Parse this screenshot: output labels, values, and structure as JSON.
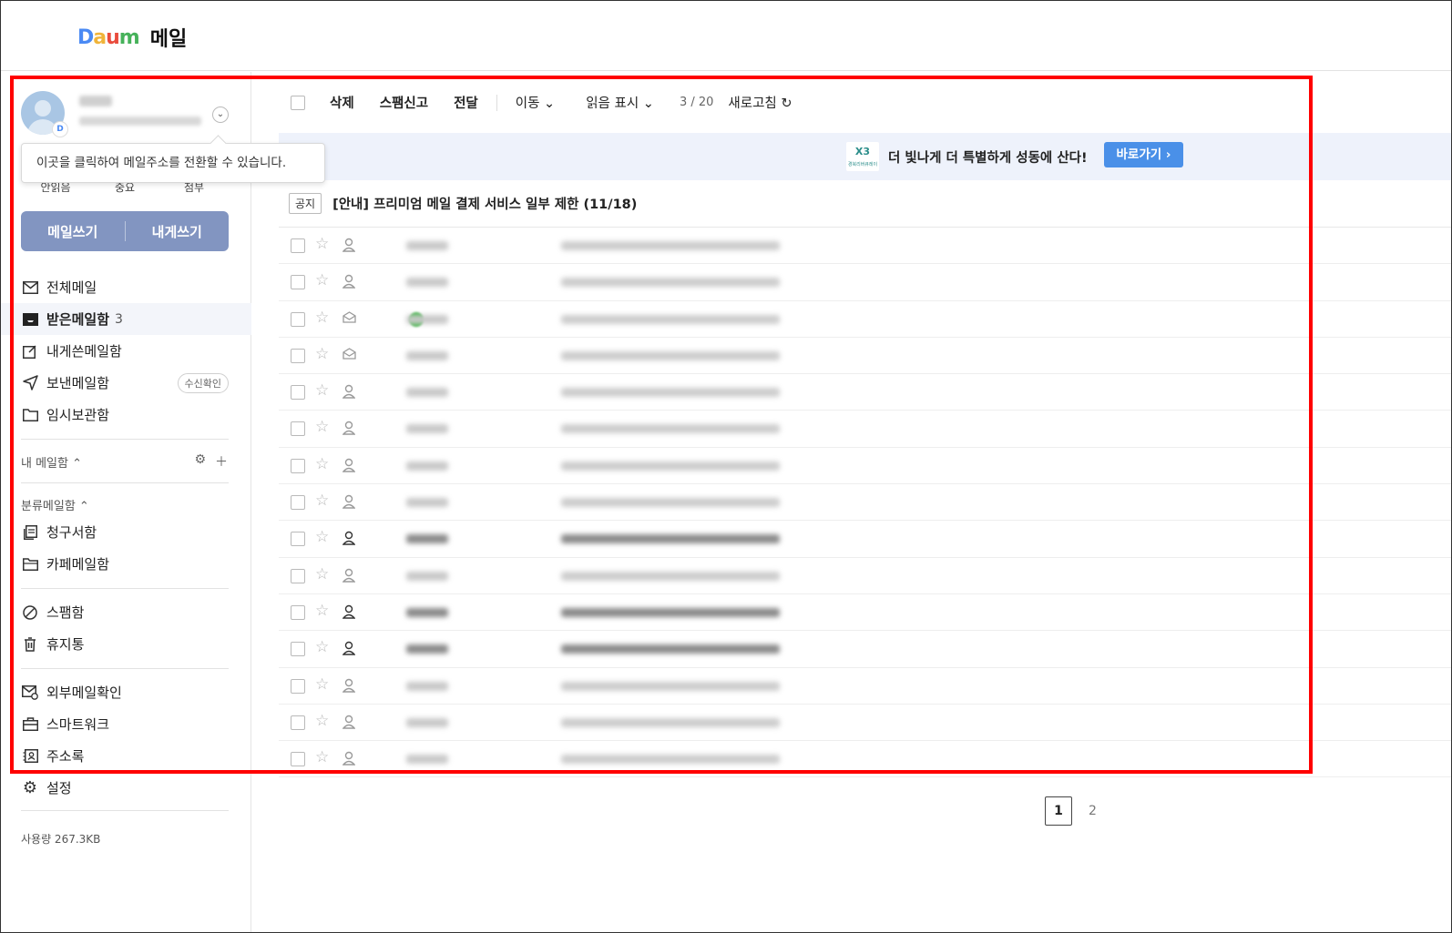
{
  "app": {
    "logo_text": "Daum",
    "title": "메일"
  },
  "sidebar": {
    "tooltip": "이곳을 클릭하여 메일주소를 전환할 수 있습니다.",
    "quick_tabs": [
      "안읽음",
      "중요",
      "첨부"
    ],
    "compose": {
      "write": "메일쓰기",
      "self": "내게쓰기"
    },
    "folders": [
      {
        "label": "전체메일",
        "icon": "envelope-icon"
      },
      {
        "label": "받은메일함",
        "count": "3",
        "icon": "inbox-icon",
        "active": true
      },
      {
        "label": "내게쓴메일함",
        "icon": "self-note-icon"
      },
      {
        "label": "보낸메일함",
        "icon": "send-icon",
        "pill": "수신확인"
      },
      {
        "label": "임시보관함",
        "icon": "folder-icon"
      }
    ],
    "my_mailbox": "내 메일함 ⌃",
    "category_title": "분류메일함 ⌃",
    "categories": [
      {
        "label": "청구서함",
        "icon": "bill-icon"
      },
      {
        "label": "카페메일함",
        "icon": "cafe-folder-icon"
      }
    ],
    "others": [
      {
        "label": "스팸함",
        "icon": "spam-icon"
      },
      {
        "label": "휴지통",
        "icon": "trash-icon"
      }
    ],
    "tools": [
      {
        "label": "외부메일확인",
        "icon": "external-mail-icon"
      },
      {
        "label": "스마트워크",
        "icon": "briefcase-icon"
      },
      {
        "label": "주소록",
        "icon": "contacts-icon"
      },
      {
        "label": "설정",
        "icon": "gear-icon"
      }
    ],
    "usage": "사용량 267.3KB"
  },
  "toolbar": {
    "delete": "삭제",
    "spam": "스팸신고",
    "forward": "전달",
    "move": "이동 ⌄",
    "mark_read": "읽음 표시 ⌄",
    "count": "3 / 20",
    "refresh": "새로고침 ↻"
  },
  "banner": {
    "logo": "X3",
    "logo_sub": "경북리버큐레이",
    "text": "더 빛나게 더 특별하게 성동에 산다!",
    "button": "바로가기 ›"
  },
  "notice": {
    "tag": "공지",
    "title": "[안내] 프리미엄 메일 결제 서비스 일부 제한 (11/18)"
  },
  "mails": [
    {
      "bold": false,
      "icon": "person"
    },
    {
      "bold": false,
      "icon": "person"
    },
    {
      "bold": false,
      "icon": "envelope",
      "green": true
    },
    {
      "bold": false,
      "icon": "envelope"
    },
    {
      "bold": false,
      "icon": "person"
    },
    {
      "bold": false,
      "icon": "person"
    },
    {
      "bold": false,
      "icon": "person"
    },
    {
      "bold": false,
      "icon": "person"
    },
    {
      "bold": true,
      "icon": "person"
    },
    {
      "bold": false,
      "icon": "person"
    },
    {
      "bold": true,
      "icon": "person"
    },
    {
      "bold": true,
      "icon": "person"
    },
    {
      "bold": false,
      "icon": "person"
    },
    {
      "bold": false,
      "icon": "person"
    },
    {
      "bold": false,
      "icon": "person"
    }
  ],
  "pagination": {
    "current": "1",
    "next": "2"
  },
  "colors": {
    "accent": "#4a90e8",
    "compose": "#8295c1",
    "highlight": "#ff0000"
  }
}
